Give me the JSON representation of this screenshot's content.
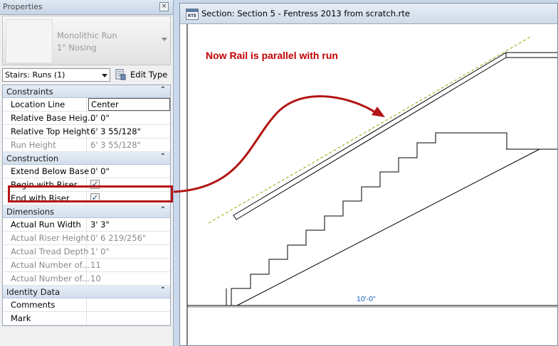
{
  "properties_panel": {
    "title": "Properties",
    "close_glyph": "×",
    "type_selector": {
      "line1": "Monolithic Run",
      "line2": "1\" Nosing",
      "thumbnail_icon": "stair-type-thumbnail"
    },
    "instance_filter": "Stairs: Runs (1)",
    "edit_type_label": "Edit Type",
    "groups": {
      "constraints": {
        "label": "Constraints",
        "rows": [
          {
            "name": "Location Line",
            "value": "Center"
          },
          {
            "name": "Relative Base Heig...",
            "value": "0'  0\""
          },
          {
            "name": "Relative Top Height",
            "value": "6'  3 55/128\""
          },
          {
            "name": "Run Height",
            "value": "6'  3 55/128\""
          }
        ]
      },
      "construction": {
        "label": "Construction",
        "rows": [
          {
            "name": "Extend Below Base",
            "value": "0'  0\""
          },
          {
            "name": "Begin with Riser",
            "value": "✓"
          },
          {
            "name": "End with Riser",
            "value": "✓"
          }
        ]
      },
      "dimensions": {
        "label": "Dimensions",
        "rows": [
          {
            "name": "Actual Run Width",
            "value": "3'  3\""
          },
          {
            "name": "Actual Riser Height",
            "value": "0'  6 219/256\""
          },
          {
            "name": "Actual Tread Depth",
            "value": "1'  0\""
          },
          {
            "name": "Actual Number of...",
            "value": "11"
          },
          {
            "name": "Actual Number of...",
            "value": "10"
          }
        ]
      },
      "identity_data": {
        "label": "Identity Data",
        "rows": [
          {
            "name": "Comments",
            "value": ""
          },
          {
            "name": "Mark",
            "value": ""
          }
        ]
      }
    }
  },
  "view": {
    "icon_label": "RTE",
    "title": "Section: Section 5 - Fentress 2013 from scratch.rte",
    "annotation": "Now Rail is parallel with run",
    "dimension_label": "10'-0\"",
    "annotation_color": "#c00000",
    "dimension_color": "#1f5fbf",
    "highlight_color": "#b31515"
  }
}
